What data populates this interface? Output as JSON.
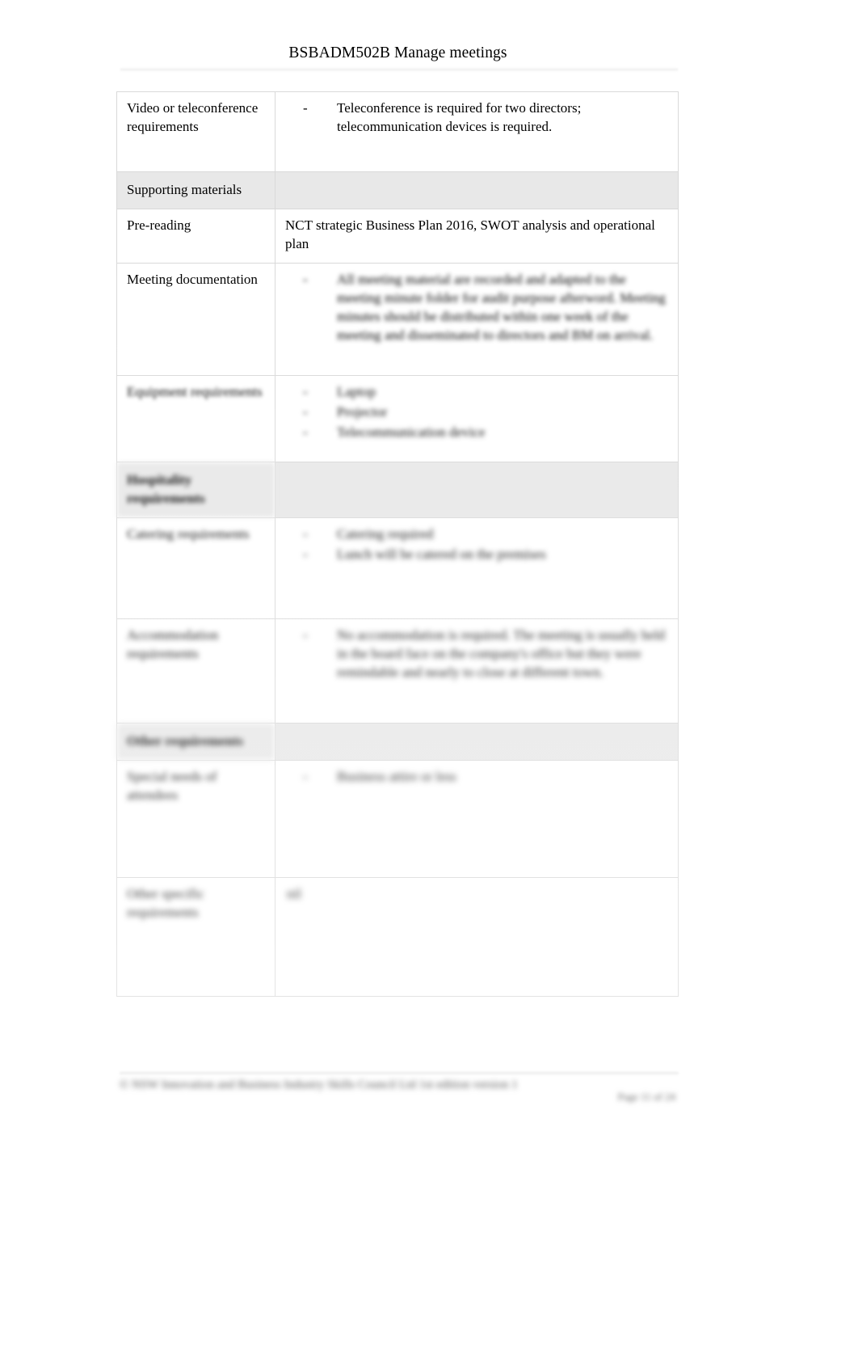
{
  "document": {
    "running_header": "BSBADM502B Manage meetings"
  },
  "table": {
    "rows": [
      {
        "kind": "data",
        "label": "Video or teleconference requirements",
        "body_type": "list",
        "marker": "-",
        "items": [
          "Teleconference is required for two directors; telecommunication devices is required."
        ],
        "legibility": "clear"
      },
      {
        "kind": "section",
        "label": "Supporting materials",
        "bold": false,
        "legibility": "clear"
      },
      {
        "kind": "data",
        "label": "Pre-reading",
        "body_type": "text",
        "text": "NCT strategic Business Plan 2016, SWOT analysis and operational plan",
        "legibility": "clear"
      },
      {
        "kind": "data",
        "label": "Meeting documentation",
        "body_type": "list",
        "marker": "-",
        "items": [
          "All meeting material are recorded and adapted to the meeting minute folder for audit purpose afterword. Meeting minutes should be distributed within one week of the meeting and disseminated to directors and BM on arrival."
        ],
        "legibility": "blurred"
      },
      {
        "kind": "data",
        "label": "Equipment requirements",
        "body_type": "list",
        "marker": "-",
        "items": [
          "Laptop",
          "Projector",
          "Telecommunication device"
        ],
        "legibility": "blurred"
      },
      {
        "kind": "section",
        "label": "Hospitality requirements",
        "bold": true,
        "legibility": "blurred"
      },
      {
        "kind": "data",
        "label": "Catering requirements",
        "body_type": "list",
        "marker": "-",
        "items": [
          "Catering required",
          "Lunch will be catered on the premises"
        ],
        "legibility": "blurred"
      },
      {
        "kind": "data",
        "label": "Accommodation requirements",
        "body_type": "list",
        "marker": "-",
        "items": [
          "No accommodation is required. The meeting is usually held in the board face on the company's office but they were remindable and nearly to close at different town."
        ],
        "legibility": "blurred"
      },
      {
        "kind": "section",
        "label": "Other requirements",
        "bold": true,
        "legibility": "blurred"
      },
      {
        "kind": "data",
        "label": "Special needs of attendees",
        "body_type": "list",
        "marker": "-",
        "items": [
          "Business attire or less"
        ],
        "legibility": "blurred"
      },
      {
        "kind": "data",
        "label": "Other specific requirements",
        "body_type": "text",
        "text": "nil",
        "legibility": "blurred"
      }
    ]
  },
  "footer": {
    "text": "© NSW Innovation and Business Industry Skills Council Ltd 1st edition version 1",
    "page": "Page 11 of 24"
  }
}
